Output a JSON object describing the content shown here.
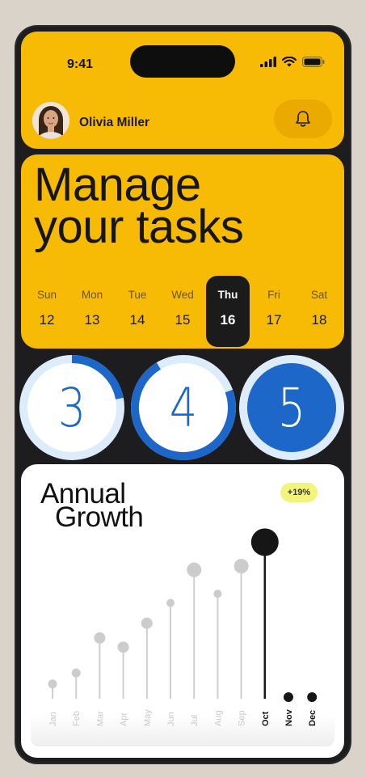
{
  "status_bar": {
    "time": "9:41"
  },
  "user": {
    "name": "Olivia Miller"
  },
  "icons": {
    "bell": "bell-icon",
    "signal": "signal-icon",
    "wifi": "wifi-icon",
    "battery": "battery-icon"
  },
  "headline": {
    "line1": "Manage",
    "line2": "your tasks"
  },
  "days": [
    {
      "name": "Sun",
      "num": "12"
    },
    {
      "name": "Mon",
      "num": "13"
    },
    {
      "name": "Tue",
      "num": "14"
    },
    {
      "name": "Wed",
      "num": "15"
    },
    {
      "name": "Thu",
      "num": "16",
      "active": true
    },
    {
      "name": "Fri",
      "num": "17"
    },
    {
      "name": "Sat",
      "num": "18"
    }
  ],
  "progress_rings": [
    {
      "value": "3",
      "progress": 0.22
    },
    {
      "value": "4",
      "progress": 0.72
    },
    {
      "value": "5",
      "progress": 1.0
    }
  ],
  "colors": {
    "accent_yellow": "#f8bb05",
    "ring_blue": "#1d67c9",
    "ring_light": "#dcecfa",
    "dark": "#1d1d1f"
  },
  "growth": {
    "title_line1": "Annual",
    "title_line2": "Growth",
    "badge": "+19%"
  },
  "chart_data": {
    "type": "lollipop",
    "categories": [
      "Jan",
      "Feb",
      "Mar",
      "Apr",
      "May",
      "Jun",
      "Jul",
      "Aug",
      "Sep",
      "Oct",
      "Nov",
      "Dec"
    ],
    "values": [
      8,
      14,
      33,
      28,
      41,
      52,
      70,
      57,
      72,
      85,
      0,
      0
    ],
    "highlight": "Oct",
    "ylim": [
      0,
      90
    ]
  }
}
